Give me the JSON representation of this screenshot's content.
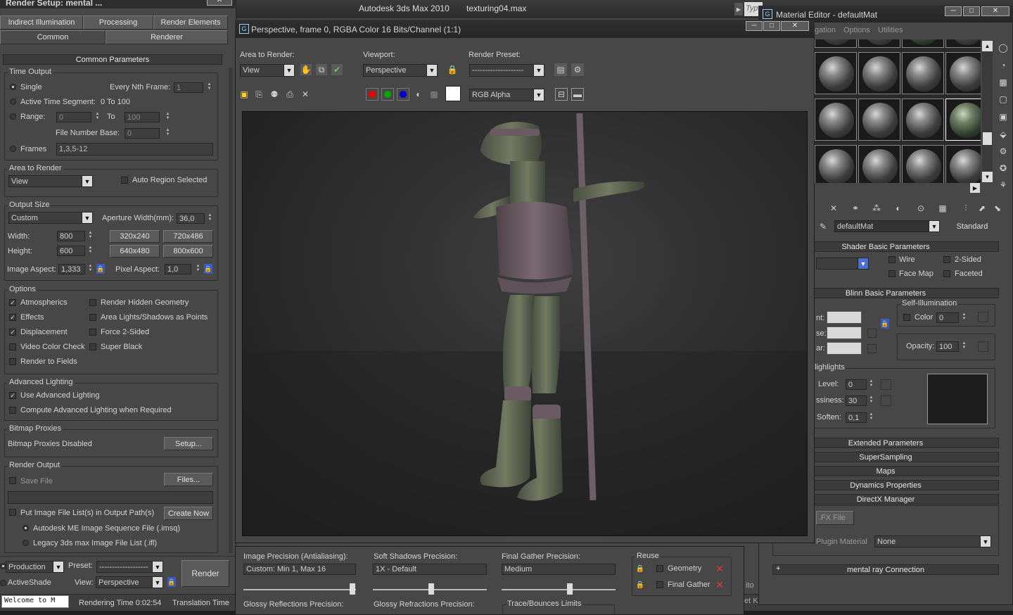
{
  "app": {
    "title": "Autodesk 3ds Max  2010",
    "file": "texturing04.max"
  },
  "render_setup": {
    "title": "Render Setup: mental ...",
    "tabs_row1": [
      "Indirect Illumination",
      "Processing",
      "Render Elements"
    ],
    "tabs_row2": [
      "Common",
      "Renderer"
    ],
    "rollout_title": "Common Parameters",
    "time_output": {
      "label": "Time Output",
      "single": "Single",
      "every_nth": "Every Nth Frame:",
      "every_nth_val": "1",
      "active_seg": "Active Time Segment:",
      "active_seg_val": "0 To 100",
      "range": "Range:",
      "range_from": "0",
      "to": "To",
      "range_to": "100",
      "file_base": "File Number Base:",
      "file_base_val": "0",
      "frames": "Frames",
      "frames_val": "1,3,5-12"
    },
    "area_to_render": {
      "label": "Area to Render",
      "value": "View",
      "auto_region": "Auto Region Selected"
    },
    "output_size": {
      "label": "Output Size",
      "preset": "Custom",
      "aperture": "Aperture Width(mm):",
      "aperture_val": "36,0",
      "width": "Width:",
      "width_val": "800",
      "height": "Height:",
      "height_val": "600",
      "presets": [
        "320x240",
        "720x486",
        "640x480",
        "800x600"
      ],
      "image_aspect": "Image Aspect:",
      "image_aspect_val": "1,333",
      "pixel_aspect": "Pixel Aspect:",
      "pixel_aspect_val": "1,0"
    },
    "options": {
      "label": "Options",
      "items": [
        {
          "label": "Atmospherics",
          "checked": "✓"
        },
        {
          "label": "Render Hidden Geometry",
          "checked": ""
        },
        {
          "label": "Effects",
          "checked": "✓"
        },
        {
          "label": "Area Lights/Shadows as Points",
          "checked": ""
        },
        {
          "label": "Displacement",
          "checked": "✓"
        },
        {
          "label": "Force 2-Sided",
          "checked": ""
        },
        {
          "label": "Video Color Check",
          "checked": ""
        },
        {
          "label": "Super Black",
          "checked": ""
        },
        {
          "label": "Render to Fields",
          "checked": ""
        }
      ]
    },
    "advanced_lighting": {
      "label": "Advanced Lighting",
      "use": "Use Advanced Lighting",
      "compute": "Compute Advanced Lighting when Required"
    },
    "bitmap_proxies": {
      "label": "Bitmap Proxies",
      "status": "Bitmap Proxies Disabled",
      "setup": "Setup..."
    },
    "render_output": {
      "label": "Render Output",
      "save_file": "Save File",
      "files": "Files...",
      "put_image": "Put Image File List(s) in Output Path(s)",
      "create_now": "Create Now",
      "imsq": "Autodesk ME Image Sequence File (.imsq)",
      "ifl": "Legacy 3ds max Image File List (.ifl)"
    },
    "bottom": {
      "mode": "Production",
      "preset_label": "Preset:",
      "preset_val": "-------------------",
      "activeshade": "ActiveShade",
      "view_label": "View:",
      "view_val": "Perspective",
      "render": "Render"
    }
  },
  "frame_window": {
    "title": "Perspective, frame 0, RGBA Color 16 Bits/Channel (1:1)",
    "area_label": "Area to Render:",
    "area_val": "View",
    "viewport_label": "Viewport:",
    "viewport_val": "Perspective",
    "preset_label": "Render Preset:",
    "preset_val": "--------------------",
    "channel": "RGB Alpha",
    "image_precision_label": "Image Precision (Antialiasing):",
    "image_precision_val": "Custom: Min 1, Max 16",
    "soft_shadows_label": "Soft Shadows Precision:",
    "soft_shadows_val": "1X - Default",
    "final_gather_label": "Final Gather Precision:",
    "final_gather_val": "Medium",
    "reuse_label": "Reuse",
    "reuse_geometry": "Geometry",
    "reuse_fg": "Final Gather",
    "glossy_refl": "Glossy Reflections Precision:",
    "glossy_refr": "Glossy Refractions Precision:",
    "trace_limits": "Trace/Bounces Limits"
  },
  "material_editor": {
    "title": "Material Editor - defaultMat",
    "menu": [
      "gation",
      "Options",
      "Utilities"
    ],
    "mat_name": "defaultMat",
    "mat_type": "Standard",
    "shader_basic": "Shader Basic Parameters",
    "wire": "Wire",
    "two_sided": "2-Sided",
    "face_map": "Face Map",
    "faceted": "Faceted",
    "blinn_basic": "Blinn Basic Parameters",
    "self_illum": "Self-Illumination",
    "color": "Color",
    "color_val": "0",
    "amb_lbl": "nt:",
    "dif_lbl": "se:",
    "spec_lbl": "ar:",
    "opacity": "Opacity:",
    "opacity_val": "100",
    "spec_highlights": "lighlights",
    "level": "Level:",
    "level_val": "0",
    "gloss": "ssiness:",
    "gloss_val": "30",
    "soften": "Soften:",
    "soften_val": "0,1",
    "rollouts": [
      "Extended Parameters",
      "SuperSampling",
      "Maps",
      "Dynamics Properties",
      "DirectX Manager"
    ],
    "fx_file": ".FX File",
    "plugin_material": "Plugin Material",
    "plugin_val": "None",
    "mental_ray": "mental ray Connection"
  },
  "status": {
    "listener": "Welcome to M",
    "render_time": "Rendering Time  0:02:54",
    "translation_time": "Translation Time",
    "side_a": "ito",
    "side_b": "et K",
    "type_hint": "Typ"
  }
}
